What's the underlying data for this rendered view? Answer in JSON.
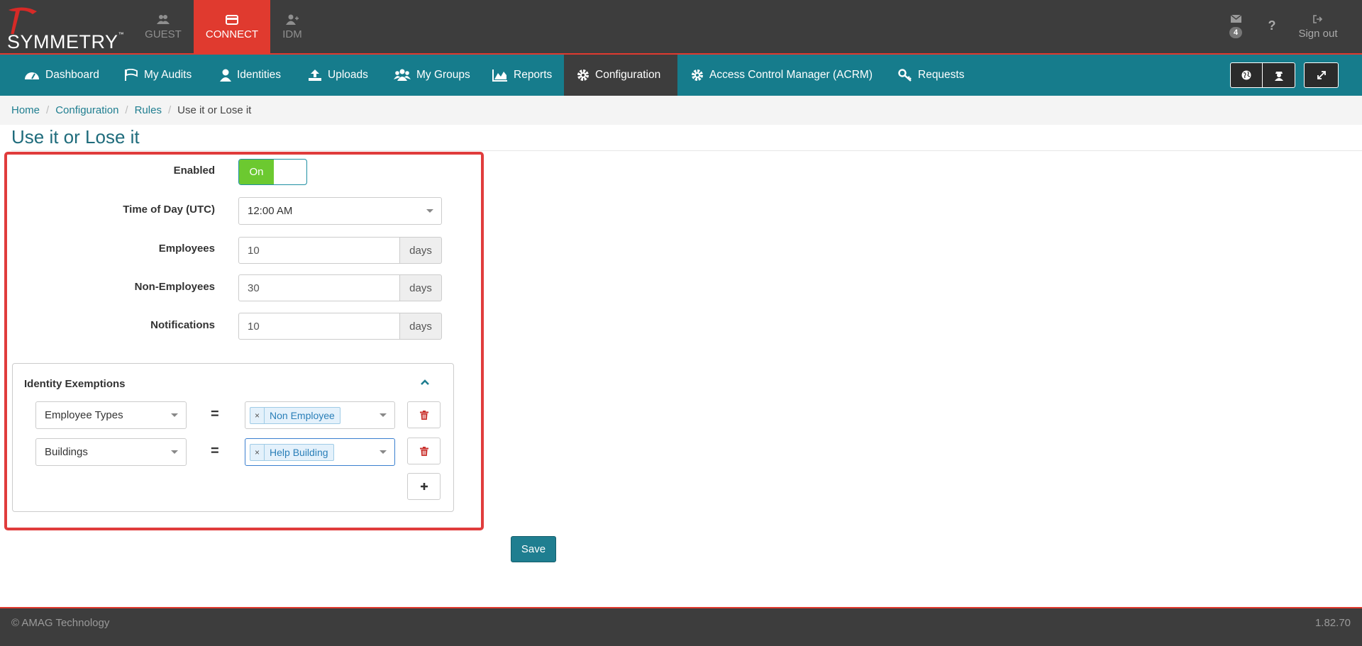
{
  "brand": {
    "logo_text": "SYMMETRY",
    "trademark": "™"
  },
  "app_tabs": [
    {
      "label": "GUEST",
      "icon": "users-icon"
    },
    {
      "label": "CONNECT",
      "icon": "card-icon",
      "active": true
    },
    {
      "label": "IDM",
      "icon": "user-plus-icon"
    }
  ],
  "top_right": {
    "messages_count": "4",
    "help_symbol": "?",
    "sign_out": "Sign out"
  },
  "nav": [
    {
      "label": "Dashboard",
      "icon": "dashboard-icon"
    },
    {
      "label": "My Audits",
      "icon": "flag-icon"
    },
    {
      "label": "Identities",
      "icon": "user-icon"
    },
    {
      "label": "Uploads",
      "icon": "upload-icon"
    },
    {
      "label": "My Groups",
      "icon": "group-icon"
    },
    {
      "label": "Reports",
      "icon": "area-chart-icon"
    },
    {
      "label": "Configuration",
      "icon": "gear-icon",
      "active": true
    },
    {
      "label": "Access Control Manager (ACRM)",
      "icon": "gear-icon"
    },
    {
      "label": "Requests",
      "icon": "key-icon"
    }
  ],
  "breadcrumb": [
    "Home",
    "Configuration",
    "Rules",
    "Use it or Lose it"
  ],
  "page_title": "Use it or Lose it",
  "form": {
    "enabled_label": "Enabled",
    "enabled_value": "On",
    "time_label": "Time of Day (UTC)",
    "time_value": "12:00 AM",
    "employees_label": "Employees",
    "employees_value": "10",
    "non_employees_label": "Non-Employees",
    "non_employees_value": "30",
    "notifications_label": "Notifications",
    "notifications_value": "10",
    "days_unit": "days"
  },
  "exemptions": {
    "title": "Identity Exemptions",
    "rows": [
      {
        "field": "Employee Types",
        "operator": "=",
        "tag_remove": "×",
        "value": "Non Employee"
      },
      {
        "field": "Buildings",
        "operator": "=",
        "tag_remove": "×",
        "value": "Help Building"
      }
    ]
  },
  "save_label": "Save",
  "footer": {
    "copyright": "© AMAG Technology",
    "version": "1.82.70"
  },
  "colors": {
    "brand_red": "#e03a2f",
    "nav_teal": "#167c8c",
    "toggle_green": "#6cc930",
    "dark": "#3d3d3d"
  }
}
